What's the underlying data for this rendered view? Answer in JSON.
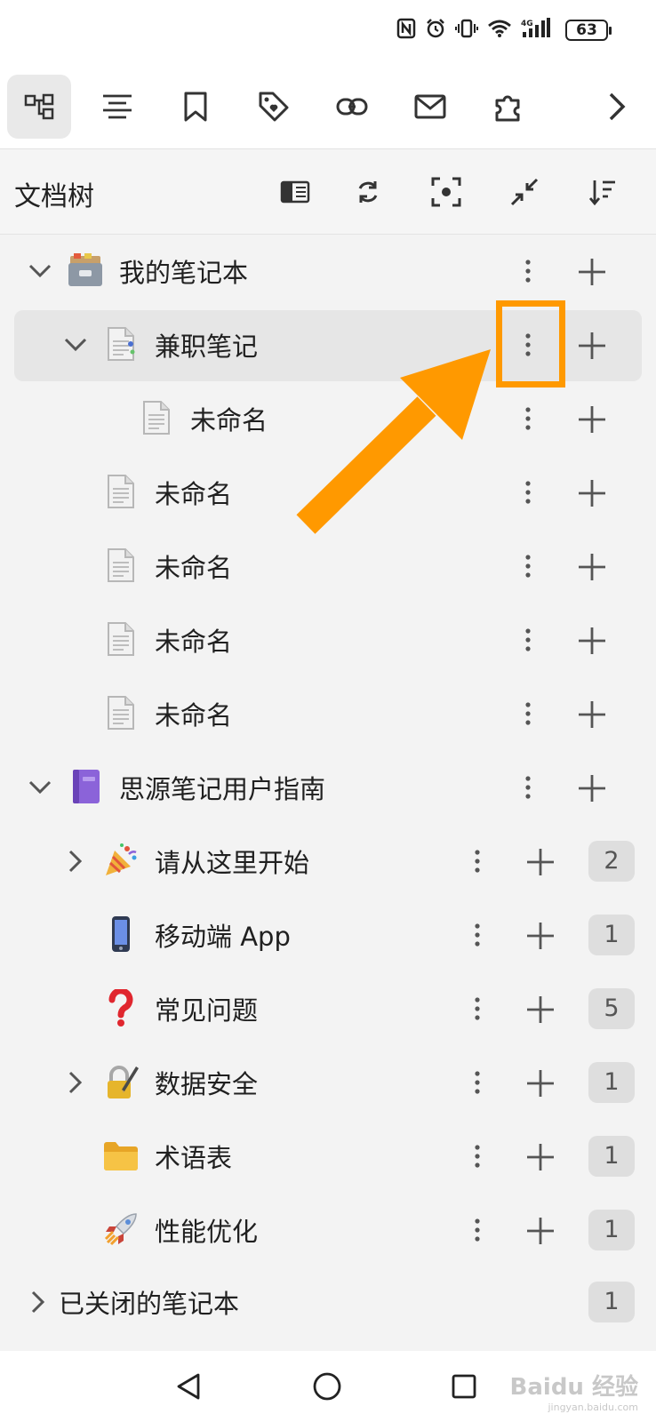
{
  "status": {
    "battery": "63"
  },
  "doc_tree": {
    "title": "文档树",
    "notebooks": [
      {
        "label": "我的笔记本",
        "icon": "card-file-box-icon"
      },
      {
        "label": "思源笔记用户指南",
        "icon": "notebook-icon"
      }
    ],
    "docs": [
      {
        "label": "兼职笔记",
        "icon": "document-icon"
      },
      {
        "label": "未命名",
        "icon": "document-icon"
      },
      {
        "label": "未命名",
        "icon": "document-icon"
      },
      {
        "label": "未命名",
        "icon": "document-icon"
      },
      {
        "label": "未命名",
        "icon": "document-icon"
      },
      {
        "label": "未命名",
        "icon": "document-icon"
      }
    ],
    "guide_docs": [
      {
        "label": "请从这里开始",
        "icon": "party-popper-icon",
        "count": "2"
      },
      {
        "label": "移动端 App",
        "icon": "mobile-phone-icon",
        "count": "1"
      },
      {
        "label": "常见问题",
        "icon": "question-mark-icon",
        "count": "5"
      },
      {
        "label": "数据安全",
        "icon": "locked-with-pen-icon",
        "count": "1"
      },
      {
        "label": "术语表",
        "icon": "folder-icon",
        "count": "1"
      },
      {
        "label": "性能优化",
        "icon": "rocket-icon",
        "count": "1"
      }
    ],
    "closed": {
      "label": "已关闭的笔记本",
      "count": "1"
    }
  },
  "watermark": {
    "text": "Baidu 经验",
    "sub": "jingyan.baidu.com"
  },
  "colors": {
    "accent": "#ff9900",
    "selected_row": "#e6e6e6"
  }
}
